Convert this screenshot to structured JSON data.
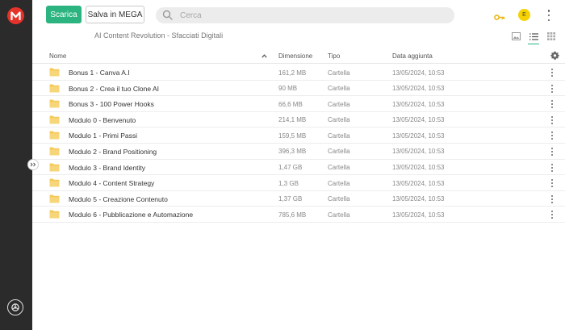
{
  "toolbar": {
    "download_label": "Scarica",
    "save_label": "Salva in MEGA"
  },
  "search": {
    "placeholder": "Cerca"
  },
  "user": {
    "initial": "E"
  },
  "breadcrumb": "AI Content Revolution - Sfacciati Digitali",
  "table": {
    "headers": {
      "name": "Nome",
      "size": "Dimensione",
      "type": "Tipo",
      "date": "Data aggiunta"
    },
    "rows": [
      {
        "name": "Bonus 1 - Canva A.I",
        "size": "161,2 MB",
        "type": "Cartella",
        "date": "13/05/2024, 10:53"
      },
      {
        "name": "Bonus 2 - Crea il tuo Clone AI",
        "size": "90 MB",
        "type": "Cartella",
        "date": "13/05/2024, 10:53"
      },
      {
        "name": "Bonus 3 - 100 Power Hooks",
        "size": "66,6 MB",
        "type": "Cartella",
        "date": "13/05/2024, 10:53"
      },
      {
        "name": "Modulo 0 - Benvenuto",
        "size": "214,1 MB",
        "type": "Cartella",
        "date": "13/05/2024, 10:53"
      },
      {
        "name": "Modulo 1 - Primi Passi",
        "size": "159,5 MB",
        "type": "Cartella",
        "date": "13/05/2024, 10:53"
      },
      {
        "name": "Modulo 2 - Brand Positioning",
        "size": "396,3 MB",
        "type": "Cartella",
        "date": "13/05/2024, 10:53"
      },
      {
        "name": "Modulo 3 - Brand Identity",
        "size": "1,47 GB",
        "type": "Cartella",
        "date": "13/05/2024, 10:53"
      },
      {
        "name": "Modulo 4 - Content Strategy",
        "size": "1,3 GB",
        "type": "Cartella",
        "date": "13/05/2024, 10:53"
      },
      {
        "name": "Modulo 5 - Creazione Contenuto",
        "size": "1,37 GB",
        "type": "Cartella",
        "date": "13/05/2024, 10:53"
      },
      {
        "name": "Modulo 6 - Pubblicazione e Automazione",
        "size": "785,6 MB",
        "type": "Cartella",
        "date": "13/05/2024, 10:53"
      }
    ]
  },
  "icons": {
    "logo": "mega-logo-icon",
    "search": "search-icon",
    "key": "key-icon",
    "more": "more-vertical-icon",
    "folder": "folder-icon",
    "settings": "gear-icon",
    "sort": "chevron-up-icon",
    "collapse": "double-chevron-right-icon",
    "sync": "sync-icon",
    "view_thumbnail": "image-view-icon",
    "view_list": "list-view-icon",
    "view_grid": "grid-view-icon"
  },
  "colors": {
    "accent": "#2bb480",
    "brand": "#e5332a",
    "sidebar": "#2b2b2b",
    "folder": "#f4c95a",
    "key": "#e8b617",
    "avatar": "#f6d200"
  }
}
